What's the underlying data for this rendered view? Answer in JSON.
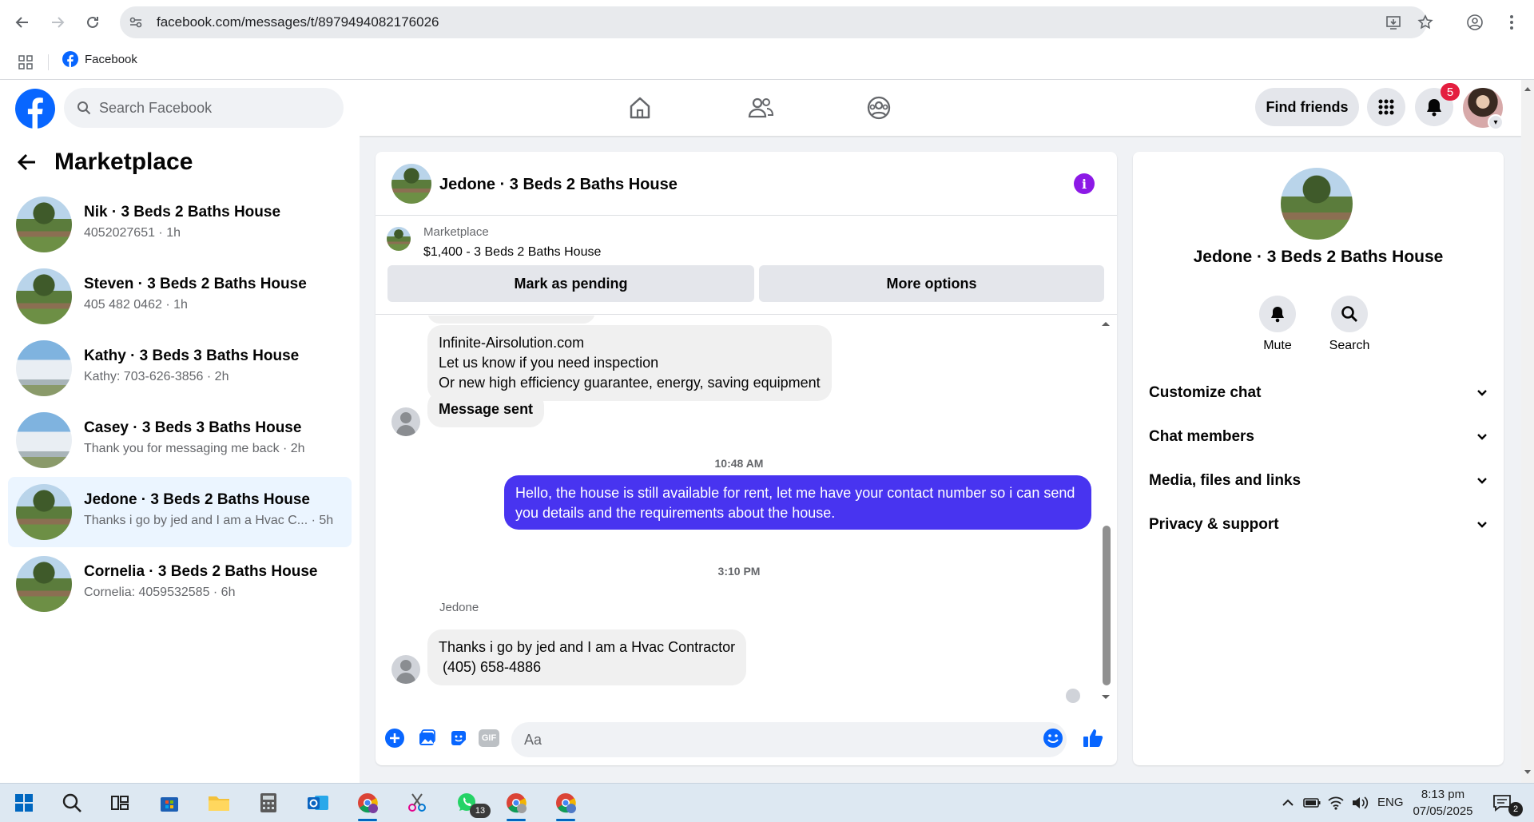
{
  "browser": {
    "url": "facebook.com/messages/t/8979494082176026",
    "bookmark_label": "Facebook"
  },
  "topbar": {
    "search_placeholder": "Search Facebook",
    "find_friends_label": "Find friends",
    "notification_count": "5"
  },
  "sidebar": {
    "title": "Marketplace",
    "conversations": [
      {
        "title": "Nik · 3 Beds 2 Baths House",
        "subtitle": "4052027651 · 1h",
        "thumb": "house1"
      },
      {
        "title": "Steven · 3 Beds 2 Baths House",
        "subtitle": "405 482 0462 · 1h",
        "thumb": "house1"
      },
      {
        "title": "Kathy · 3 Beds 3 Baths House",
        "subtitle": "Kathy: 703-626-3856 · 2h",
        "thumb": "house2"
      },
      {
        "title": "Casey · 3 Beds 3 Baths House",
        "subtitle": "Thank you for messaging me back · 2h",
        "thumb": "house2"
      },
      {
        "title": "Jedone · 3 Beds 2 Baths House",
        "subtitle": "Thanks i go by jed and I am a Hvac C...  · 5h",
        "thumb": "house1",
        "active": true
      },
      {
        "title": "Cornelia · 3 Beds 2 Baths House",
        "subtitle": "Cornelia: 4059532585 · 6h",
        "thumb": "house1"
      }
    ]
  },
  "chat": {
    "title": "Jedone · 3 Beds 2 Baths House",
    "marketplace_label": "Marketplace",
    "listing": "$1,400 - 3 Beds 2 Baths House",
    "mark_pending_label": "Mark as pending",
    "more_options_label": "More options",
    "messages": {
      "promo_line1": "Infinite-Airsolution.com",
      "promo_line2": "Let us know if you need inspection",
      "promo_line3": "Or new high efficiency  guarantee,  energy, saving equipment",
      "message_sent": "Message sent",
      "time1": "10:48 AM",
      "outgoing": "Hello, the house is still available for rent, let me have your contact number so i can send you details and the requirements about the house.",
      "time2": "3:10 PM",
      "sender": "Jedone",
      "reply_line1": "Thanks i go by jed and I am a Hvac Contractor",
      "reply_line2": " (405) 658-4886"
    },
    "input_placeholder": "Aa",
    "gif_label": "GIF"
  },
  "info_panel": {
    "name": "Jedone · 3 Beds 2 Baths House",
    "mute_label": "Mute",
    "search_label": "Search",
    "sections": [
      "Customize chat",
      "Chat members",
      "Media, files and links",
      "Privacy & support"
    ]
  },
  "taskbar": {
    "whatsapp_badge": "13",
    "language": "ENG",
    "time": "8:13 pm",
    "date": "07/05/2025",
    "notification_badge": "2"
  },
  "colors": {
    "fb_blue": "#0866ff",
    "outgoing_bubble": "#4834f0",
    "active_conversation": "#ebf5ff",
    "info_icon": "#8c19e6"
  }
}
